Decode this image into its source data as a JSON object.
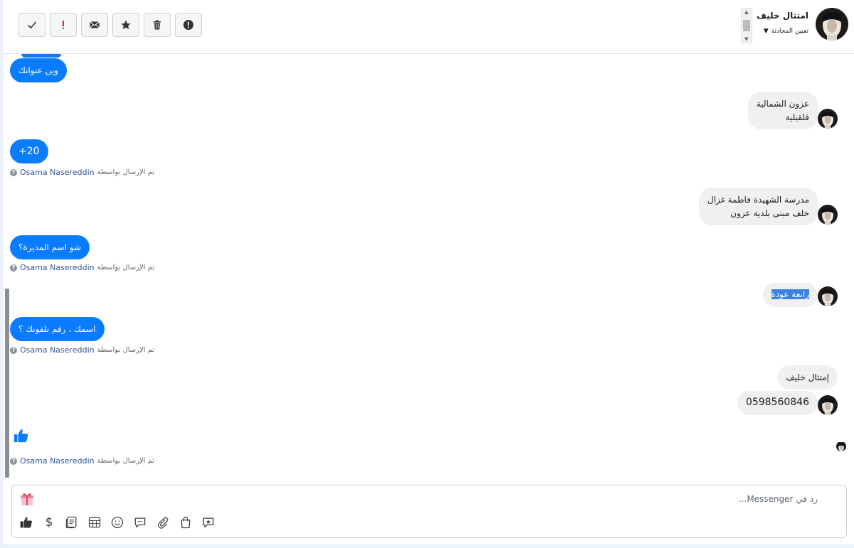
{
  "header": {
    "contact_name": "امتثال خليف",
    "assign_label": "تعيين المحادثة",
    "toolbar": [
      {
        "name": "mark-done",
        "icon": "check-icon"
      },
      {
        "name": "mark-important",
        "icon": "exclamation-icon"
      },
      {
        "name": "mark-unread",
        "icon": "envelope-icon"
      },
      {
        "name": "star",
        "icon": "star-icon"
      },
      {
        "name": "delete",
        "icon": "trash-icon"
      },
      {
        "name": "report-spam",
        "icon": "alert-circle-icon"
      }
    ]
  },
  "messages": {
    "m1": "وين عنوانك",
    "m2_line1": "عزون الشمالية",
    "m2_line2": "قلقيلية",
    "m3": "+20",
    "m4_line1": "مدرسة الشهيدة فاطمة غزال",
    "m4_line2": "خلف مبنى بلدية عزون",
    "m5": "شو اسم المديرة؟",
    "m6": "رابعة عودة",
    "m7": "اسمك ، رقم تلفونك ؟",
    "m8": "إمتثال خليف",
    "m9": "0598560846"
  },
  "sent_by": {
    "label": "تم الإرسال بواسطة",
    "agent": "Osama Nasereddin"
  },
  "composer": {
    "placeholder": "رد في Messenger..."
  },
  "colors": {
    "outgoing": "#0a7cff",
    "incoming": "#f0f0f0",
    "link": "#365899"
  }
}
